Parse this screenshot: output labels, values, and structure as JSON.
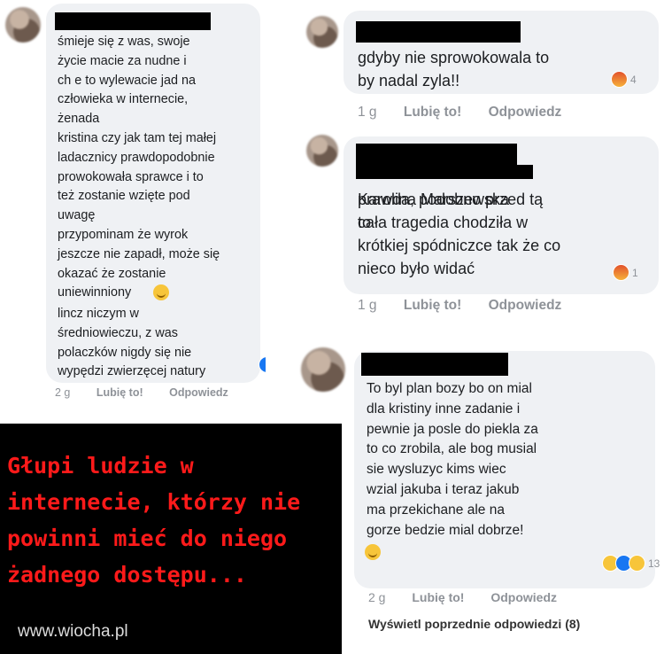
{
  "comments": [
    {
      "text": "śmieje się z was, swoje\nżycie macie za nudne i\nch        e to wylewacie jad na\nczłowieka w internecie,\nżenada\nkristina czy jak tam tej małej\nladacznicy prawdopodobnie\nprowokowała sprawce i to\nteż zostanie wzięte pod\nuwagę\nprzypominam że wyrok\njeszcze nie zapadł, może się\nokazać że zostanie\nuniewinniony",
      "text_after_emoji": "lincz niczym w\nśredniowieczu, z was\npolaczków nigdy się nie\nwypędzi zwierzęcej natury",
      "time": "2 g",
      "like": "Lubię to!",
      "reply": "Odpowiedz",
      "reactions": [
        "like-icon",
        "love-icon",
        "haha-icon"
      ]
    },
    {
      "text": "gdyby nie sprowokowala to\nby nadal zyla!!",
      "time": "1 g",
      "like": "Lubię to!",
      "reply": "Odpowiedz",
      "reaction_count": "4",
      "reactions": [
        "angry-icon"
      ]
    },
    {
      "text_redacted_name": "Karolina Marszewska",
      "text_after_name": "to",
      "text": "prawda, podobno przed tą\ncała tragedia chodziła w\nkrótkiej spódniczce tak że co\nnieco było widać",
      "time": "1 g",
      "like": "Lubię to!",
      "reply": "Odpowiedz",
      "reaction_count": "1",
      "reactions": [
        "angry-icon"
      ]
    },
    {
      "text": "To byl plan bozy bo on mial\ndla kristiny inne zadanie i\npewnie ja posle do piekla za\nto co zrobila, ale bog musial\nsie wysluzyc kims wiec\nwzial jakuba i teraz jakub\nma przekichane ale na\ngorze bedzie mial dobrze!",
      "time": "2 g",
      "like": "Lubię to!",
      "reply": "Odpowiedz",
      "reaction_count": "13",
      "reactions": [
        "haha-icon",
        "like-icon",
        "wow-icon"
      ],
      "more_replies": "Wyświetl poprzednie odpowiedzi (8)"
    }
  ],
  "caption": "Głupi ludzie w\ninternecie, którzy nie\npowinni mieć do niego\nżadnego dostępu...",
  "watermark": "www.wiocha.pl",
  "colors": {
    "bubble": "#eff1f4",
    "caption": "#ff1a1a",
    "meta": "#8e9298"
  }
}
